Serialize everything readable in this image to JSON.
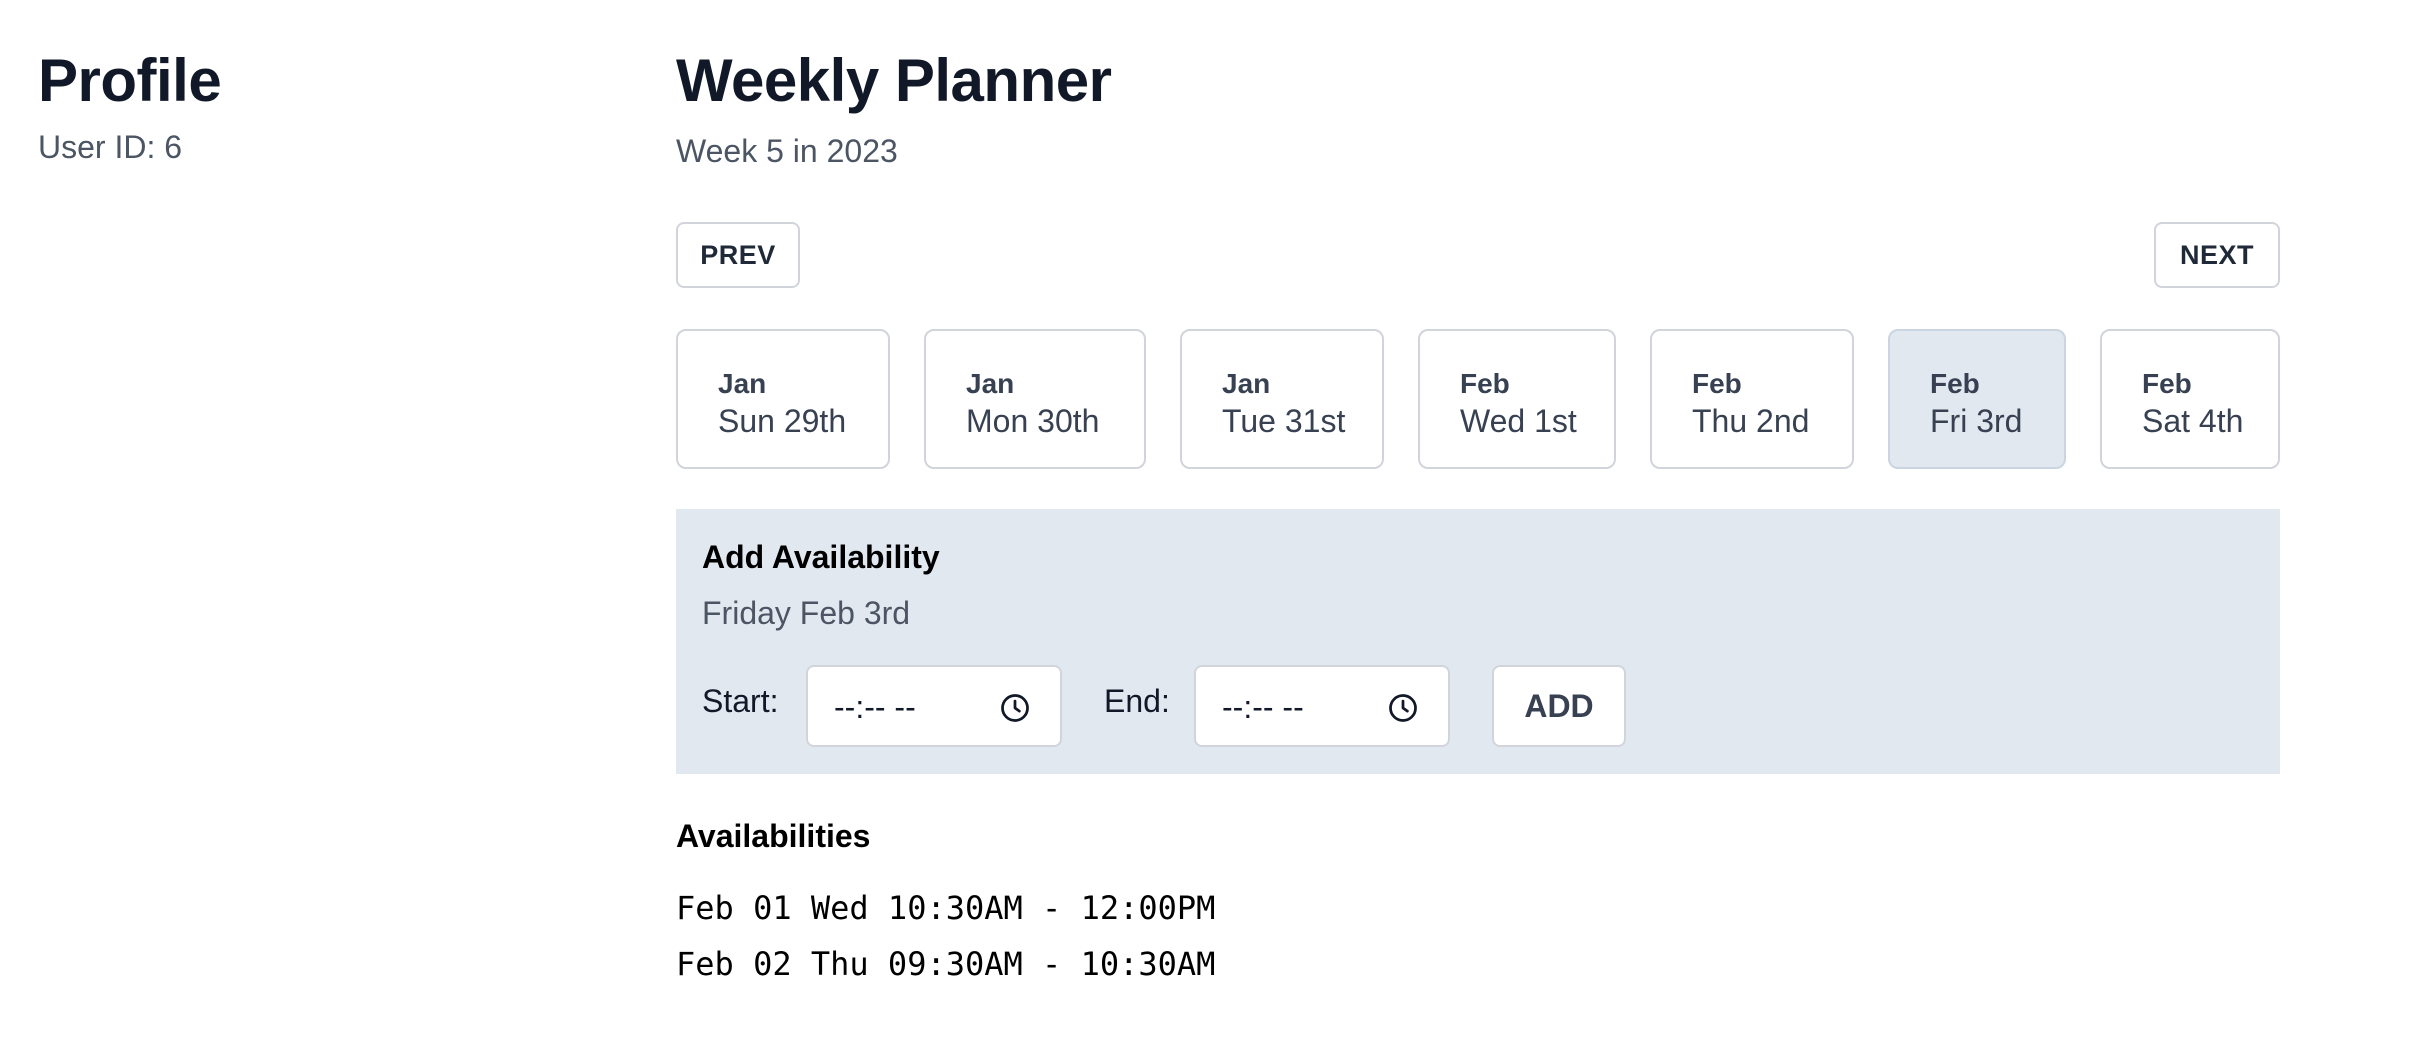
{
  "profile": {
    "title": "Profile",
    "user_id": "User ID: 6"
  },
  "planner": {
    "title": "Weekly Planner",
    "week_label": "Week 5 in 2023",
    "prev_label": "PREV",
    "next_label": "NEXT",
    "days": [
      {
        "month": "Jan",
        "day": "Sun 29th",
        "selected": false
      },
      {
        "month": "Jan",
        "day": "Mon 30th",
        "selected": false
      },
      {
        "month": "Jan",
        "day": "Tue 31st",
        "selected": false
      },
      {
        "month": "Feb",
        "day": "Wed 1st",
        "selected": false
      },
      {
        "month": "Feb",
        "day": "Thu 2nd",
        "selected": false
      },
      {
        "month": "Feb",
        "day": "Fri 3rd",
        "selected": true
      },
      {
        "month": "Feb",
        "day": "Sat 4th",
        "selected": false
      }
    ]
  },
  "add_availability": {
    "title": "Add Availability",
    "selected_date": "Friday Feb 3rd",
    "start_label": "Start:",
    "start_value": "--:-- --",
    "end_label": "End:",
    "end_value": "--:-- --",
    "add_label": "ADD",
    "clock_icon": "clock-icon"
  },
  "availabilities": {
    "title": "Availabilities",
    "items": [
      "Feb 01 Wed 10:30AM - 12:00PM",
      "Feb 02 Thu 09:30AM - 10:30AM"
    ]
  },
  "colors": {
    "selected_day_bg": "#e2e8f0",
    "panel_bg": "#e2e8f0",
    "border": "#d1d5db"
  }
}
